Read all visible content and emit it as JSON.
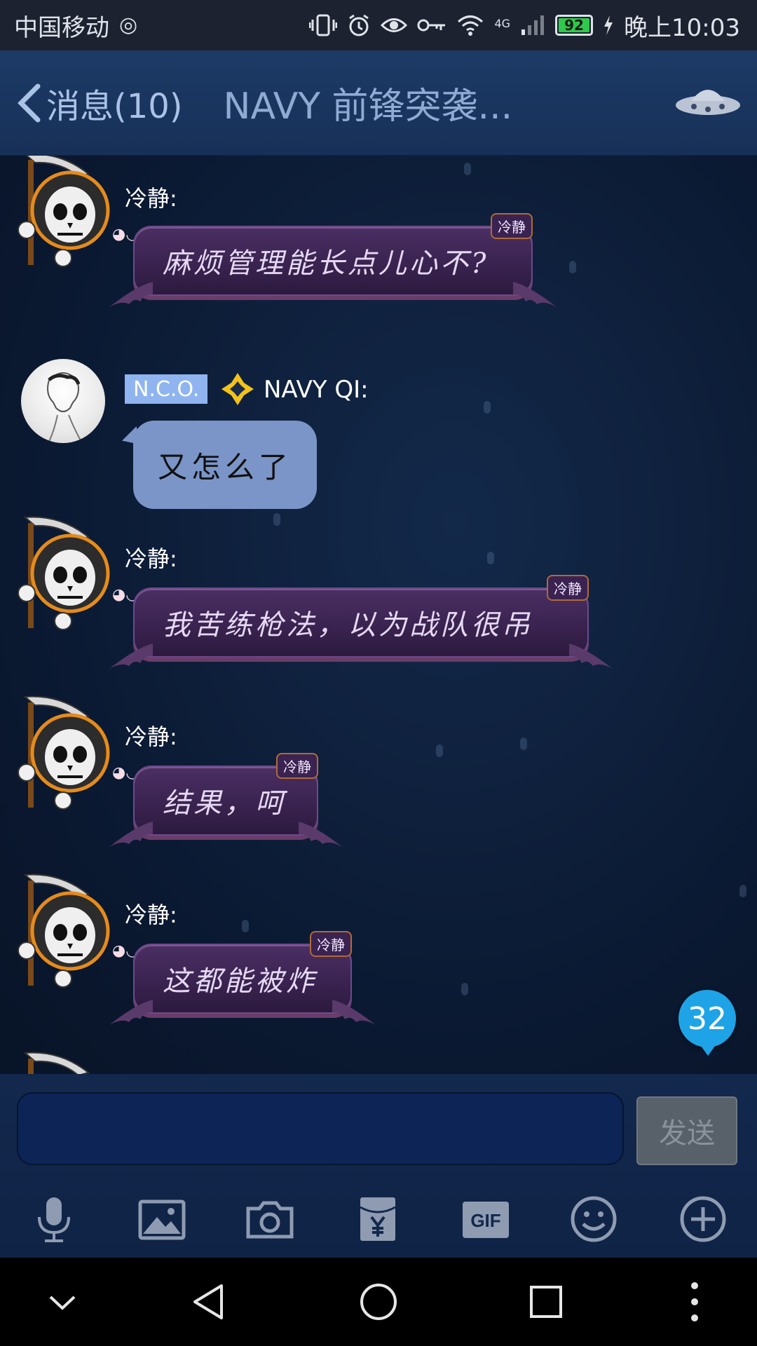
{
  "status_bar": {
    "carrier": "中国移动",
    "network": "4G",
    "battery": "92",
    "time": "晚上10:03"
  },
  "header": {
    "back_label": "消息(10)",
    "title": "NAVY 前锋突袭..."
  },
  "messages": [
    {
      "sender": "冷静:",
      "text": "麻烦管理能长点儿心不?",
      "tag": "冷静"
    },
    {
      "rank": "N.C.O.",
      "sender": "NAVY QI:",
      "text": "又怎么了"
    },
    {
      "sender": "冷静:",
      "text": "我苦练枪法，以为战队很吊",
      "tag": "冷静"
    },
    {
      "sender": "冷静:",
      "text": "结果，呵",
      "tag": "冷静"
    },
    {
      "sender": "冷静:",
      "text": "这都能被炸",
      "tag": "冷静"
    }
  ],
  "unread_count": "32",
  "input": {
    "placeholder": "",
    "send_label": "发送"
  },
  "toolbar_icons": [
    "microphone-icon",
    "image-icon",
    "camera-icon",
    "red-packet-icon",
    "gif-icon",
    "emoji-icon",
    "plus-icon"
  ],
  "colors": {
    "header_bg": "#1c3b66",
    "chat_bg": "#0a1830",
    "purple_bubble": "#3a2350",
    "blue_bubble": "#7b95c8",
    "unread_badge": "#1ea4e6",
    "send_button": "#58606a"
  }
}
